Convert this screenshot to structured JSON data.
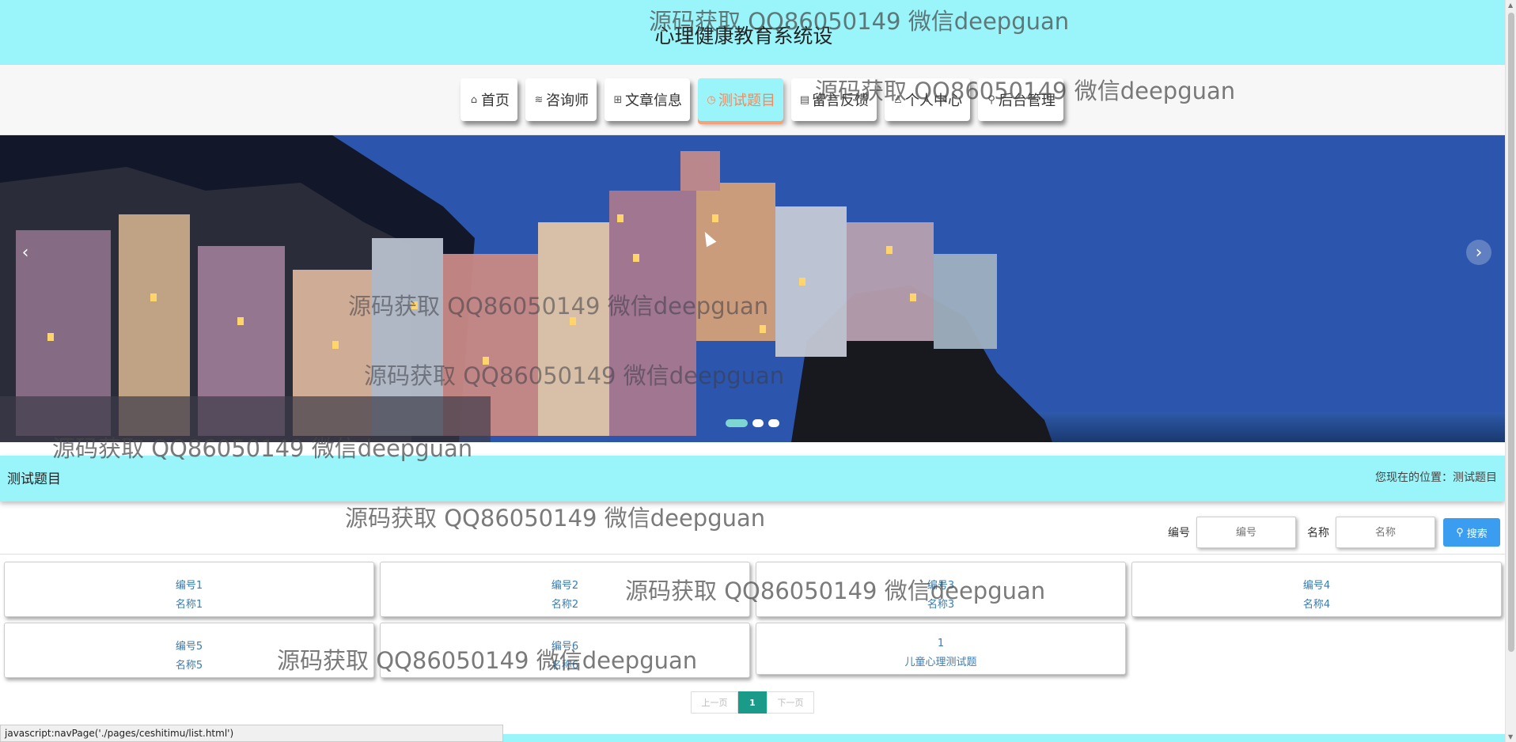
{
  "site": {
    "title": "心理健康教育系统设"
  },
  "nav": [
    {
      "icon": "home-icon",
      "glyph": "⌂",
      "label": "首页"
    },
    {
      "icon": "layers-icon",
      "glyph": "≋",
      "label": "咨询师"
    },
    {
      "icon": "book-icon",
      "glyph": "⊞",
      "label": "文章信息"
    },
    {
      "icon": "clock-icon",
      "glyph": "◷",
      "label": "测试题目"
    },
    {
      "icon": "message-icon",
      "glyph": "▤",
      "label": "留言反馈"
    },
    {
      "icon": "user-icon",
      "glyph": "♙",
      "label": "个人中心"
    },
    {
      "icon": "link-icon",
      "glyph": "⚲",
      "label": "后台管理"
    }
  ],
  "banner": {
    "prev": "‹",
    "next": "›"
  },
  "section": {
    "title": "测试题目",
    "location": "您现在的位置：测试题目"
  },
  "search": {
    "label_number": "编号",
    "placeholder_number": "编号",
    "label_name": "名称",
    "placeholder_name": "名称",
    "button": "搜索"
  },
  "cards": [
    {
      "line1": "编号1",
      "line2": "名称1"
    },
    {
      "line1": "编号2",
      "line2": "名称2"
    },
    {
      "line1": "编号3",
      "line2": "名称3"
    },
    {
      "line1": "编号4",
      "line2": "名称4"
    },
    {
      "line1": "编号5",
      "line2": "名称5"
    },
    {
      "line1": "编号6",
      "line2": "名称6"
    },
    {
      "line1": "1",
      "line2": "儿童心理测试题"
    }
  ],
  "pager": {
    "prev": "上一页",
    "current": "1",
    "next": "下一页"
  },
  "status_url": "javascript:navPage('./pages/ceshitimu/list.html')",
  "watermark": "源码获取 QQ86050149 微信deepguan",
  "colors": {
    "header_bg": "#9af5fa",
    "active_text": "#f08a5d",
    "search_button": "#3a9df0",
    "pager_active": "#1a9b8a"
  }
}
